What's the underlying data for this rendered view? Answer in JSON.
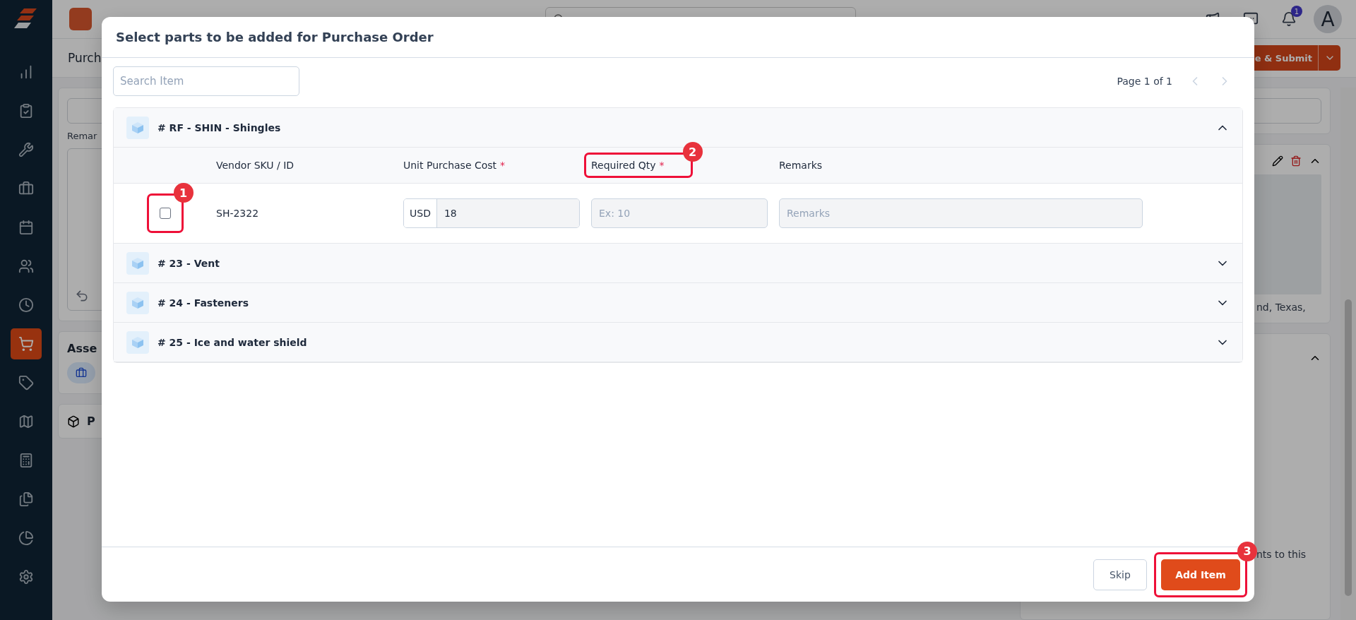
{
  "app": {
    "notifications": "1",
    "avatar": "A"
  },
  "nav": [
    {
      "kind": "reports",
      "selected": false
    },
    {
      "kind": "tasks",
      "selected": false
    },
    {
      "kind": "tools",
      "selected": false
    },
    {
      "kind": "jobs",
      "selected": false
    },
    {
      "kind": "calendar",
      "selected": false
    },
    {
      "kind": "people",
      "selected": false
    },
    {
      "kind": "time",
      "selected": false
    },
    {
      "kind": "cart",
      "selected": true
    },
    {
      "kind": "tags",
      "selected": false
    },
    {
      "kind": "map",
      "selected": false
    },
    {
      "kind": "calculator",
      "selected": false
    },
    {
      "kind": "files",
      "selected": false
    },
    {
      "kind": "chart",
      "selected": false
    },
    {
      "kind": "settings",
      "selected": false
    }
  ],
  "page": {
    "title": "Purch",
    "submit_button": "e & Submit",
    "remarks_label": "Remar",
    "assets_title": "Asse",
    "parts_title": "P",
    "location_text": "nd, Texas,",
    "attachments_text": "nts to this"
  },
  "modal": {
    "title": "Select parts to be added for Purchase Order",
    "search": {
      "placeholder": "Search Item"
    },
    "pagination": "Page 1 of 1",
    "groups": [
      {
        "title": "# RF - SHIN - Shingles",
        "expanded": true,
        "columns": [
          {
            "label": "Vendor SKU / ID"
          },
          {
            "label": "Unit Purchase Cost",
            "mark": "*"
          },
          {
            "label": "Required Qty",
            "mark": "*",
            "callout": "2"
          },
          {
            "label": "Remarks"
          }
        ],
        "rows": [
          {
            "checked": false,
            "callout": "1",
            "sku": "SH-2322",
            "currency": "USD",
            "unit_cost": "18",
            "qty_placeholder": "Ex: 10",
            "remarks_placeholder": "Remarks"
          }
        ]
      },
      {
        "title": "# 23 - Vent",
        "expanded": false
      },
      {
        "title": "# 24 - Fasteners",
        "expanded": false
      },
      {
        "title": "# 25 - Ice and water shield",
        "expanded": false
      }
    ],
    "buttons": [
      {
        "label": "Skip",
        "kind": "secondary"
      },
      {
        "label": "Add Item",
        "kind": "primary",
        "callout": "3"
      }
    ]
  }
}
